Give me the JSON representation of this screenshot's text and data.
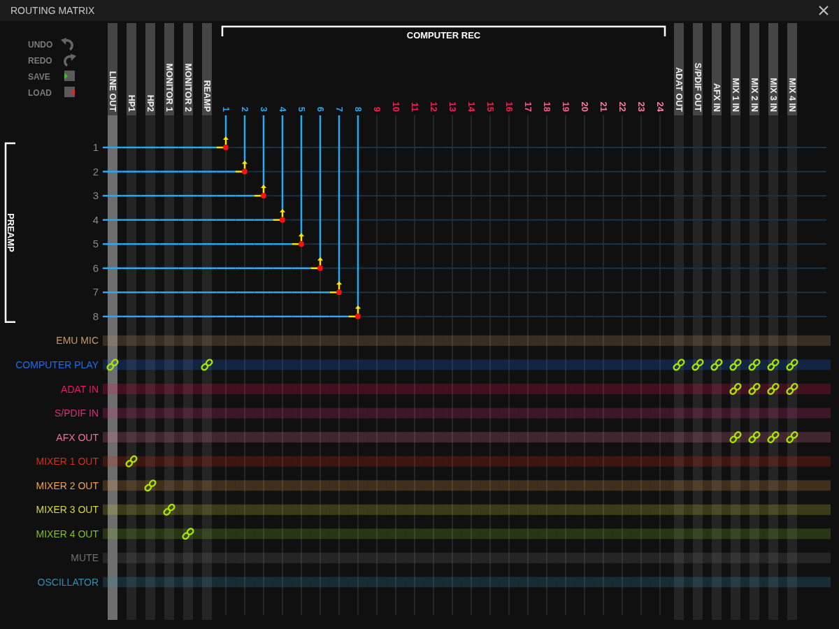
{
  "window": {
    "title": "ROUTING MATRIX"
  },
  "toolbar": [
    {
      "label": "UNDO",
      "kind": "undo"
    },
    {
      "label": "REDO",
      "kind": "redo"
    },
    {
      "label": "SAVE",
      "kind": "save"
    },
    {
      "label": "LOAD",
      "kind": "load"
    }
  ],
  "column_group": {
    "label": "COMPUTER REC"
  },
  "row_group": {
    "label": "PREAMP"
  },
  "columns": [
    {
      "label": "LINE OUT",
      "kind": "output",
      "selected": true
    },
    {
      "label": "HP1",
      "kind": "output",
      "selected": false
    },
    {
      "label": "HP2",
      "kind": "output",
      "selected": false
    },
    {
      "label": "MONITOR 1",
      "kind": "output",
      "selected": false
    },
    {
      "label": "MONITOR 2",
      "kind": "output",
      "selected": false
    },
    {
      "label": "REAMP",
      "kind": "output",
      "selected": false
    },
    {
      "label": "1",
      "kind": "channel",
      "color": "#2aa4ee",
      "selected": false
    },
    {
      "label": "2",
      "kind": "channel",
      "color": "#2aa4ee",
      "selected": false
    },
    {
      "label": "3",
      "kind": "channel",
      "color": "#2aa4ee",
      "selected": false
    },
    {
      "label": "4",
      "kind": "channel",
      "color": "#2aa4ee",
      "selected": false
    },
    {
      "label": "5",
      "kind": "channel",
      "color": "#2aa4ee",
      "selected": false
    },
    {
      "label": "6",
      "kind": "channel",
      "color": "#2aa4ee",
      "selected": false
    },
    {
      "label": "7",
      "kind": "channel",
      "color": "#2aa4ee",
      "selected": false
    },
    {
      "label": "8",
      "kind": "channel",
      "color": "#2aa4ee",
      "selected": false
    },
    {
      "label": "9",
      "kind": "channel",
      "color": "#ff1a55",
      "selected": false
    },
    {
      "label": "10",
      "kind": "channel",
      "color": "#ff1a55",
      "selected": false
    },
    {
      "label": "11",
      "kind": "channel",
      "color": "#ff1a55",
      "selected": false
    },
    {
      "label": "12",
      "kind": "channel",
      "color": "#ff1a55",
      "selected": false
    },
    {
      "label": "13",
      "kind": "channel",
      "color": "#ff1a55",
      "selected": false
    },
    {
      "label": "14",
      "kind": "channel",
      "color": "#ff1a55",
      "selected": false
    },
    {
      "label": "15",
      "kind": "channel",
      "color": "#ff1a55",
      "selected": false
    },
    {
      "label": "16",
      "kind": "channel",
      "color": "#ff1a55",
      "selected": false
    },
    {
      "label": "17",
      "kind": "channel",
      "color": "#ff5a88",
      "selected": false
    },
    {
      "label": "18",
      "kind": "channel",
      "color": "#ff5a88",
      "selected": false
    },
    {
      "label": "19",
      "kind": "channel",
      "color": "#ff5a88",
      "selected": false
    },
    {
      "label": "20",
      "kind": "channel",
      "color": "#ff7aa2",
      "selected": false
    },
    {
      "label": "21",
      "kind": "channel",
      "color": "#ff7aa2",
      "selected": false
    },
    {
      "label": "22",
      "kind": "channel",
      "color": "#ff7aa2",
      "selected": false
    },
    {
      "label": "23",
      "kind": "channel",
      "color": "#ff7aa2",
      "selected": false
    },
    {
      "label": "24",
      "kind": "channel",
      "color": "#ff7aa2",
      "selected": false
    },
    {
      "label": "ADAT OUT",
      "kind": "output",
      "selected": false
    },
    {
      "label": "S/PDIF OUT",
      "kind": "output",
      "selected": false
    },
    {
      "label": "AFX IN",
      "kind": "output",
      "selected": false
    },
    {
      "label": "MIX 1 IN",
      "kind": "output",
      "selected": false
    },
    {
      "label": "MIX 2 IN",
      "kind": "output",
      "selected": false
    },
    {
      "label": "MIX 3 IN",
      "kind": "output",
      "selected": false
    },
    {
      "label": "MIX 4 IN",
      "kind": "output",
      "selected": false
    }
  ],
  "rows": [
    {
      "label": "1",
      "kind": "preamp",
      "connected": [
        false,
        false,
        false,
        false,
        false,
        false,
        true,
        false,
        false,
        false,
        false,
        false,
        false,
        false,
        false,
        false,
        false,
        false,
        false,
        false,
        false,
        false,
        false,
        false,
        false,
        false,
        false,
        false,
        false,
        false,
        false,
        false,
        false,
        false,
        false,
        false,
        false
      ]
    },
    {
      "label": "2",
      "kind": "preamp",
      "connected": [
        false,
        false,
        false,
        false,
        false,
        false,
        false,
        true,
        false,
        false,
        false,
        false,
        false,
        false,
        false,
        false,
        false,
        false,
        false,
        false,
        false,
        false,
        false,
        false,
        false,
        false,
        false,
        false,
        false,
        false,
        false,
        false,
        false,
        false,
        false,
        false,
        false
      ]
    },
    {
      "label": "3",
      "kind": "preamp",
      "connected": [
        false,
        false,
        false,
        false,
        false,
        false,
        false,
        false,
        true,
        false,
        false,
        false,
        false,
        false,
        false,
        false,
        false,
        false,
        false,
        false,
        false,
        false,
        false,
        false,
        false,
        false,
        false,
        false,
        false,
        false,
        false,
        false,
        false,
        false,
        false,
        false,
        false
      ]
    },
    {
      "label": "4",
      "kind": "preamp",
      "connected": [
        false,
        false,
        false,
        false,
        false,
        false,
        false,
        false,
        false,
        true,
        false,
        false,
        false,
        false,
        false,
        false,
        false,
        false,
        false,
        false,
        false,
        false,
        false,
        false,
        false,
        false,
        false,
        false,
        false,
        false,
        false,
        false,
        false,
        false,
        false,
        false,
        false
      ]
    },
    {
      "label": "5",
      "kind": "preamp",
      "connected": [
        false,
        false,
        false,
        false,
        false,
        false,
        false,
        false,
        false,
        false,
        true,
        false,
        false,
        false,
        false,
        false,
        false,
        false,
        false,
        false,
        false,
        false,
        false,
        false,
        false,
        false,
        false,
        false,
        false,
        false,
        false,
        false,
        false,
        false,
        false,
        false,
        false
      ]
    },
    {
      "label": "6",
      "kind": "preamp",
      "connected": [
        false,
        false,
        false,
        false,
        false,
        false,
        false,
        false,
        false,
        false,
        false,
        true,
        false,
        false,
        false,
        false,
        false,
        false,
        false,
        false,
        false,
        false,
        false,
        false,
        false,
        false,
        false,
        false,
        false,
        false,
        false,
        false,
        false,
        false,
        false,
        false,
        false
      ]
    },
    {
      "label": "7",
      "kind": "preamp",
      "connected": [
        false,
        false,
        false,
        false,
        false,
        false,
        false,
        false,
        false,
        false,
        false,
        false,
        true,
        false,
        false,
        false,
        false,
        false,
        false,
        false,
        false,
        false,
        false,
        false,
        false,
        false,
        false,
        false,
        false,
        false,
        false,
        false,
        false,
        false,
        false,
        false,
        false
      ]
    },
    {
      "label": "8",
      "kind": "preamp",
      "connected": [
        false,
        false,
        false,
        false,
        false,
        false,
        false,
        false,
        false,
        false,
        false,
        false,
        false,
        true,
        false,
        false,
        false,
        false,
        false,
        false,
        false,
        false,
        false,
        false,
        false,
        false,
        false,
        false,
        false,
        false,
        false,
        false,
        false,
        false,
        false,
        false,
        false
      ]
    },
    {
      "label": "EMU MIC",
      "kind": "source",
      "color": "#c89a6a",
      "connected": [
        false,
        false,
        false,
        false,
        false,
        false,
        false,
        false,
        false,
        false,
        false,
        false,
        false,
        false,
        false,
        false,
        false,
        false,
        false,
        false,
        false,
        false,
        false,
        false,
        false,
        false,
        false,
        false,
        false,
        false,
        false,
        false,
        false,
        false,
        false,
        false,
        false
      ]
    },
    {
      "label": "COMPUTER PLAY",
      "kind": "source",
      "color": "#1a6ef0",
      "connected": [
        true,
        false,
        false,
        false,
        false,
        true,
        false,
        false,
        false,
        false,
        false,
        false,
        false,
        false,
        false,
        false,
        false,
        false,
        false,
        false,
        false,
        false,
        false,
        false,
        false,
        false,
        false,
        false,
        false,
        false,
        true,
        true,
        true,
        true,
        true,
        true,
        true
      ]
    },
    {
      "label": "ADAT IN",
      "kind": "source",
      "color": "#f0185a",
      "connected": [
        false,
        false,
        false,
        false,
        false,
        false,
        false,
        false,
        false,
        false,
        false,
        false,
        false,
        false,
        false,
        false,
        false,
        false,
        false,
        false,
        false,
        false,
        false,
        false,
        false,
        false,
        false,
        false,
        false,
        false,
        false,
        false,
        false,
        true,
        true,
        true,
        true
      ]
    },
    {
      "label": "S/PDIF IN",
      "kind": "source",
      "color": "#d8307a",
      "connected": [
        false,
        false,
        false,
        false,
        false,
        false,
        false,
        false,
        false,
        false,
        false,
        false,
        false,
        false,
        false,
        false,
        false,
        false,
        false,
        false,
        false,
        false,
        false,
        false,
        false,
        false,
        false,
        false,
        false,
        false,
        false,
        false,
        false,
        false,
        false,
        false,
        false
      ]
    },
    {
      "label": "AFX OUT",
      "kind": "source",
      "color": "#f070a0",
      "connected": [
        false,
        false,
        false,
        false,
        false,
        false,
        false,
        false,
        false,
        false,
        false,
        false,
        false,
        false,
        false,
        false,
        false,
        false,
        false,
        false,
        false,
        false,
        false,
        false,
        false,
        false,
        false,
        false,
        false,
        false,
        false,
        false,
        false,
        true,
        true,
        true,
        true
      ]
    },
    {
      "label": "MIXER 1 OUT",
      "kind": "source",
      "color": "#d83010",
      "connected": [
        false,
        true,
        false,
        false,
        false,
        false,
        false,
        false,
        false,
        false,
        false,
        false,
        false,
        false,
        false,
        false,
        false,
        false,
        false,
        false,
        false,
        false,
        false,
        false,
        false,
        false,
        false,
        false,
        false,
        false,
        false,
        false,
        false,
        false,
        false,
        false,
        false
      ]
    },
    {
      "label": "MIXER 2 OUT",
      "kind": "source",
      "color": "#f0a050",
      "connected": [
        false,
        false,
        true,
        false,
        false,
        false,
        false,
        false,
        false,
        false,
        false,
        false,
        false,
        false,
        false,
        false,
        false,
        false,
        false,
        false,
        false,
        false,
        false,
        false,
        false,
        false,
        false,
        false,
        false,
        false,
        false,
        false,
        false,
        false,
        false,
        false,
        false
      ]
    },
    {
      "label": "MIXER 3 OUT",
      "kind": "source",
      "color": "#d8d840",
      "connected": [
        false,
        false,
        false,
        true,
        false,
        false,
        false,
        false,
        false,
        false,
        false,
        false,
        false,
        false,
        false,
        false,
        false,
        false,
        false,
        false,
        false,
        false,
        false,
        false,
        false,
        false,
        false,
        false,
        false,
        false,
        false,
        false,
        false,
        false,
        false,
        false,
        false
      ]
    },
    {
      "label": "MIXER 4 OUT",
      "kind": "source",
      "color": "#80c020",
      "connected": [
        false,
        false,
        false,
        false,
        true,
        false,
        false,
        false,
        false,
        false,
        false,
        false,
        false,
        false,
        false,
        false,
        false,
        false,
        false,
        false,
        false,
        false,
        false,
        false,
        false,
        false,
        false,
        false,
        false,
        false,
        false,
        false,
        false,
        false,
        false,
        false,
        false
      ]
    },
    {
      "label": "MUTE",
      "kind": "source",
      "color": "#707070",
      "connected": [
        false,
        false,
        false,
        false,
        false,
        false,
        false,
        false,
        false,
        false,
        false,
        false,
        false,
        false,
        false,
        false,
        false,
        false,
        false,
        false,
        false,
        false,
        false,
        false,
        false,
        false,
        false,
        false,
        false,
        false,
        false,
        false,
        false,
        false,
        false,
        false,
        false
      ]
    },
    {
      "label": "OSCILLATOR",
      "kind": "source",
      "color": "#3090b0",
      "connected": [
        false,
        false,
        false,
        false,
        false,
        false,
        false,
        false,
        false,
        false,
        false,
        false,
        false,
        false,
        false,
        false,
        false,
        false,
        false,
        false,
        false,
        false,
        false,
        false,
        false,
        false,
        false,
        false,
        false,
        false,
        false,
        false,
        false,
        false,
        false,
        false,
        false
      ]
    }
  ]
}
